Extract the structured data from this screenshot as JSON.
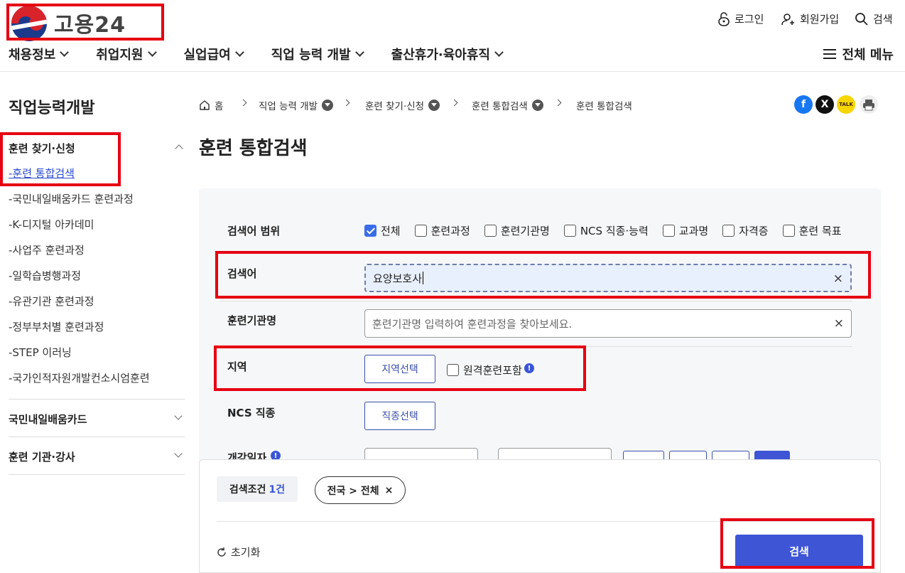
{
  "header": {
    "logo_text": "고용24",
    "util": {
      "login": "로그인",
      "signup": "회원가입",
      "search": "검색"
    },
    "nav": [
      "채용정보",
      "취업지원",
      "실업급여",
      "직업 능력 개발",
      "출산휴가·육아휴직"
    ],
    "all_menu": "전체 메뉴"
  },
  "sidebar": {
    "title": "직업능력개발",
    "section1": "훈련 찾기·신청",
    "items": [
      "-훈련 통합검색",
      "-국민내일배움카드 훈련과정",
      "-K-디지털 아카데미",
      "-사업주 훈련과정",
      "-일학습병행과정",
      "-유관기관 훈련과정",
      "-정부부처별 훈련과정",
      "-STEP 이러닝",
      "-국가인적자원개발컨소시엄훈련"
    ],
    "section2": "국민내일배움카드",
    "section3": "훈련 기관·강사"
  },
  "breadcrumb": {
    "home": "홈",
    "c1": "직업 능력 개발",
    "c2": "훈련 찾기·신청",
    "c3": "훈련 통합검색",
    "c4": "훈련 통합검색"
  },
  "share": {
    "kakao": "TALK"
  },
  "page_title": "훈련 통합검색",
  "form": {
    "scope_label": "검색어 범위",
    "scope_options": [
      {
        "label": "전체",
        "checked": true
      },
      {
        "label": "훈련과정",
        "checked": false
      },
      {
        "label": "훈련기관명",
        "checked": false
      },
      {
        "label": "NCS 직종·능력",
        "checked": false
      },
      {
        "label": "교과명",
        "checked": false
      },
      {
        "label": "자격증",
        "checked": false
      },
      {
        "label": "훈련 목표",
        "checked": false
      }
    ],
    "keyword_label": "검색어",
    "keyword_value": "요양보호사",
    "institution_label": "훈련기관명",
    "institution_placeholder": "훈련기관명 입력하여 훈련과정을 찾아보세요.",
    "region_label": "지역",
    "region_button": "지역선택",
    "remote_label": "원격훈련포함",
    "ncs_label": "NCS 직종",
    "ncs_button": "직종선택",
    "date_label": "개강일자"
  },
  "bottom": {
    "cond_label": "검색조건",
    "cond_count": "1건",
    "chip": "전국 > 전체",
    "reset": "초기화",
    "search": "검색"
  },
  "colors": {
    "accent": "#3e55d6",
    "highlight": "#e60012"
  }
}
